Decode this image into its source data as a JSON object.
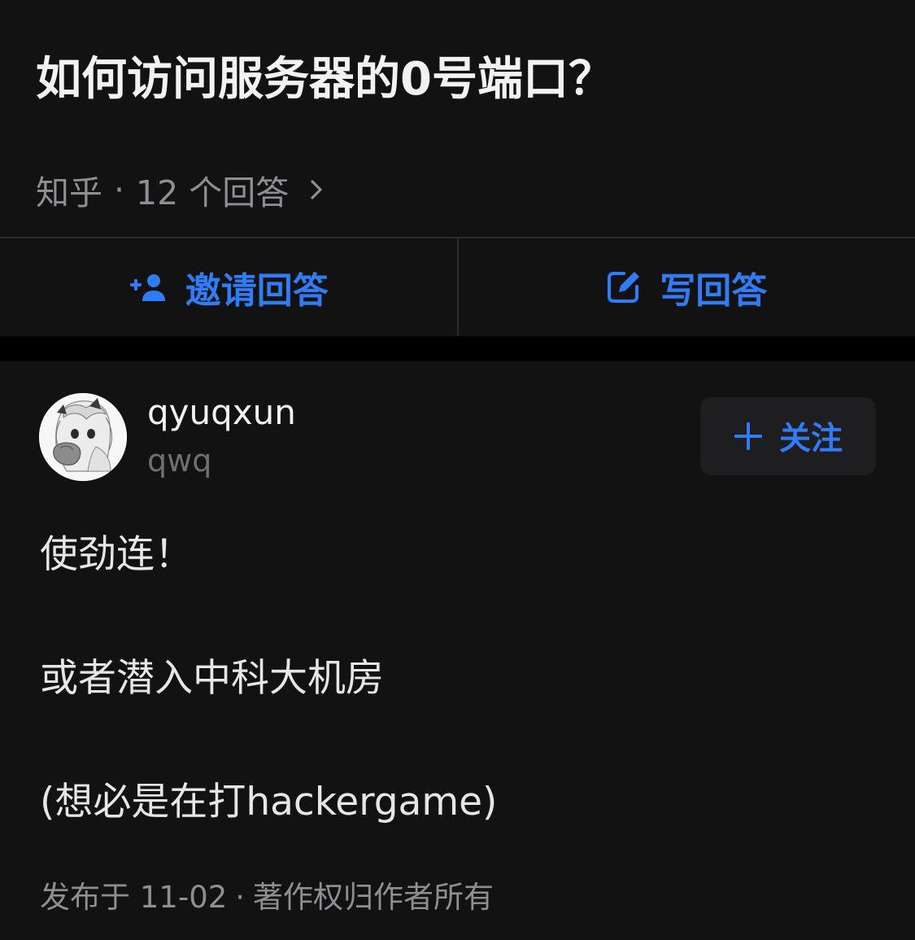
{
  "question": {
    "title": "如何访问服务器的0号端口？",
    "source": "知乎",
    "dot": "·",
    "answer_count": "12 个回答"
  },
  "actions": {
    "invite_label": "邀请回答",
    "write_label": "写回答"
  },
  "answer": {
    "author_name": "qyuqxun",
    "author_bio": "qwq",
    "follow_label": "关注",
    "lines": [
      "使劲连！",
      "或者潜入中科大机房",
      "(想必是在打hackergame)"
    ],
    "published": "发布于 11-02",
    "separator": "·",
    "copyright": "著作权归作者所有"
  },
  "colors": {
    "accent": "#2f7cf6",
    "background": "#121212",
    "divider": "#000000",
    "secondary_text": "#8e8e93"
  },
  "icons": {
    "chevron": "chevron-right-icon",
    "invite": "person-add-icon",
    "write": "edit-icon",
    "follow": "plus-icon"
  }
}
